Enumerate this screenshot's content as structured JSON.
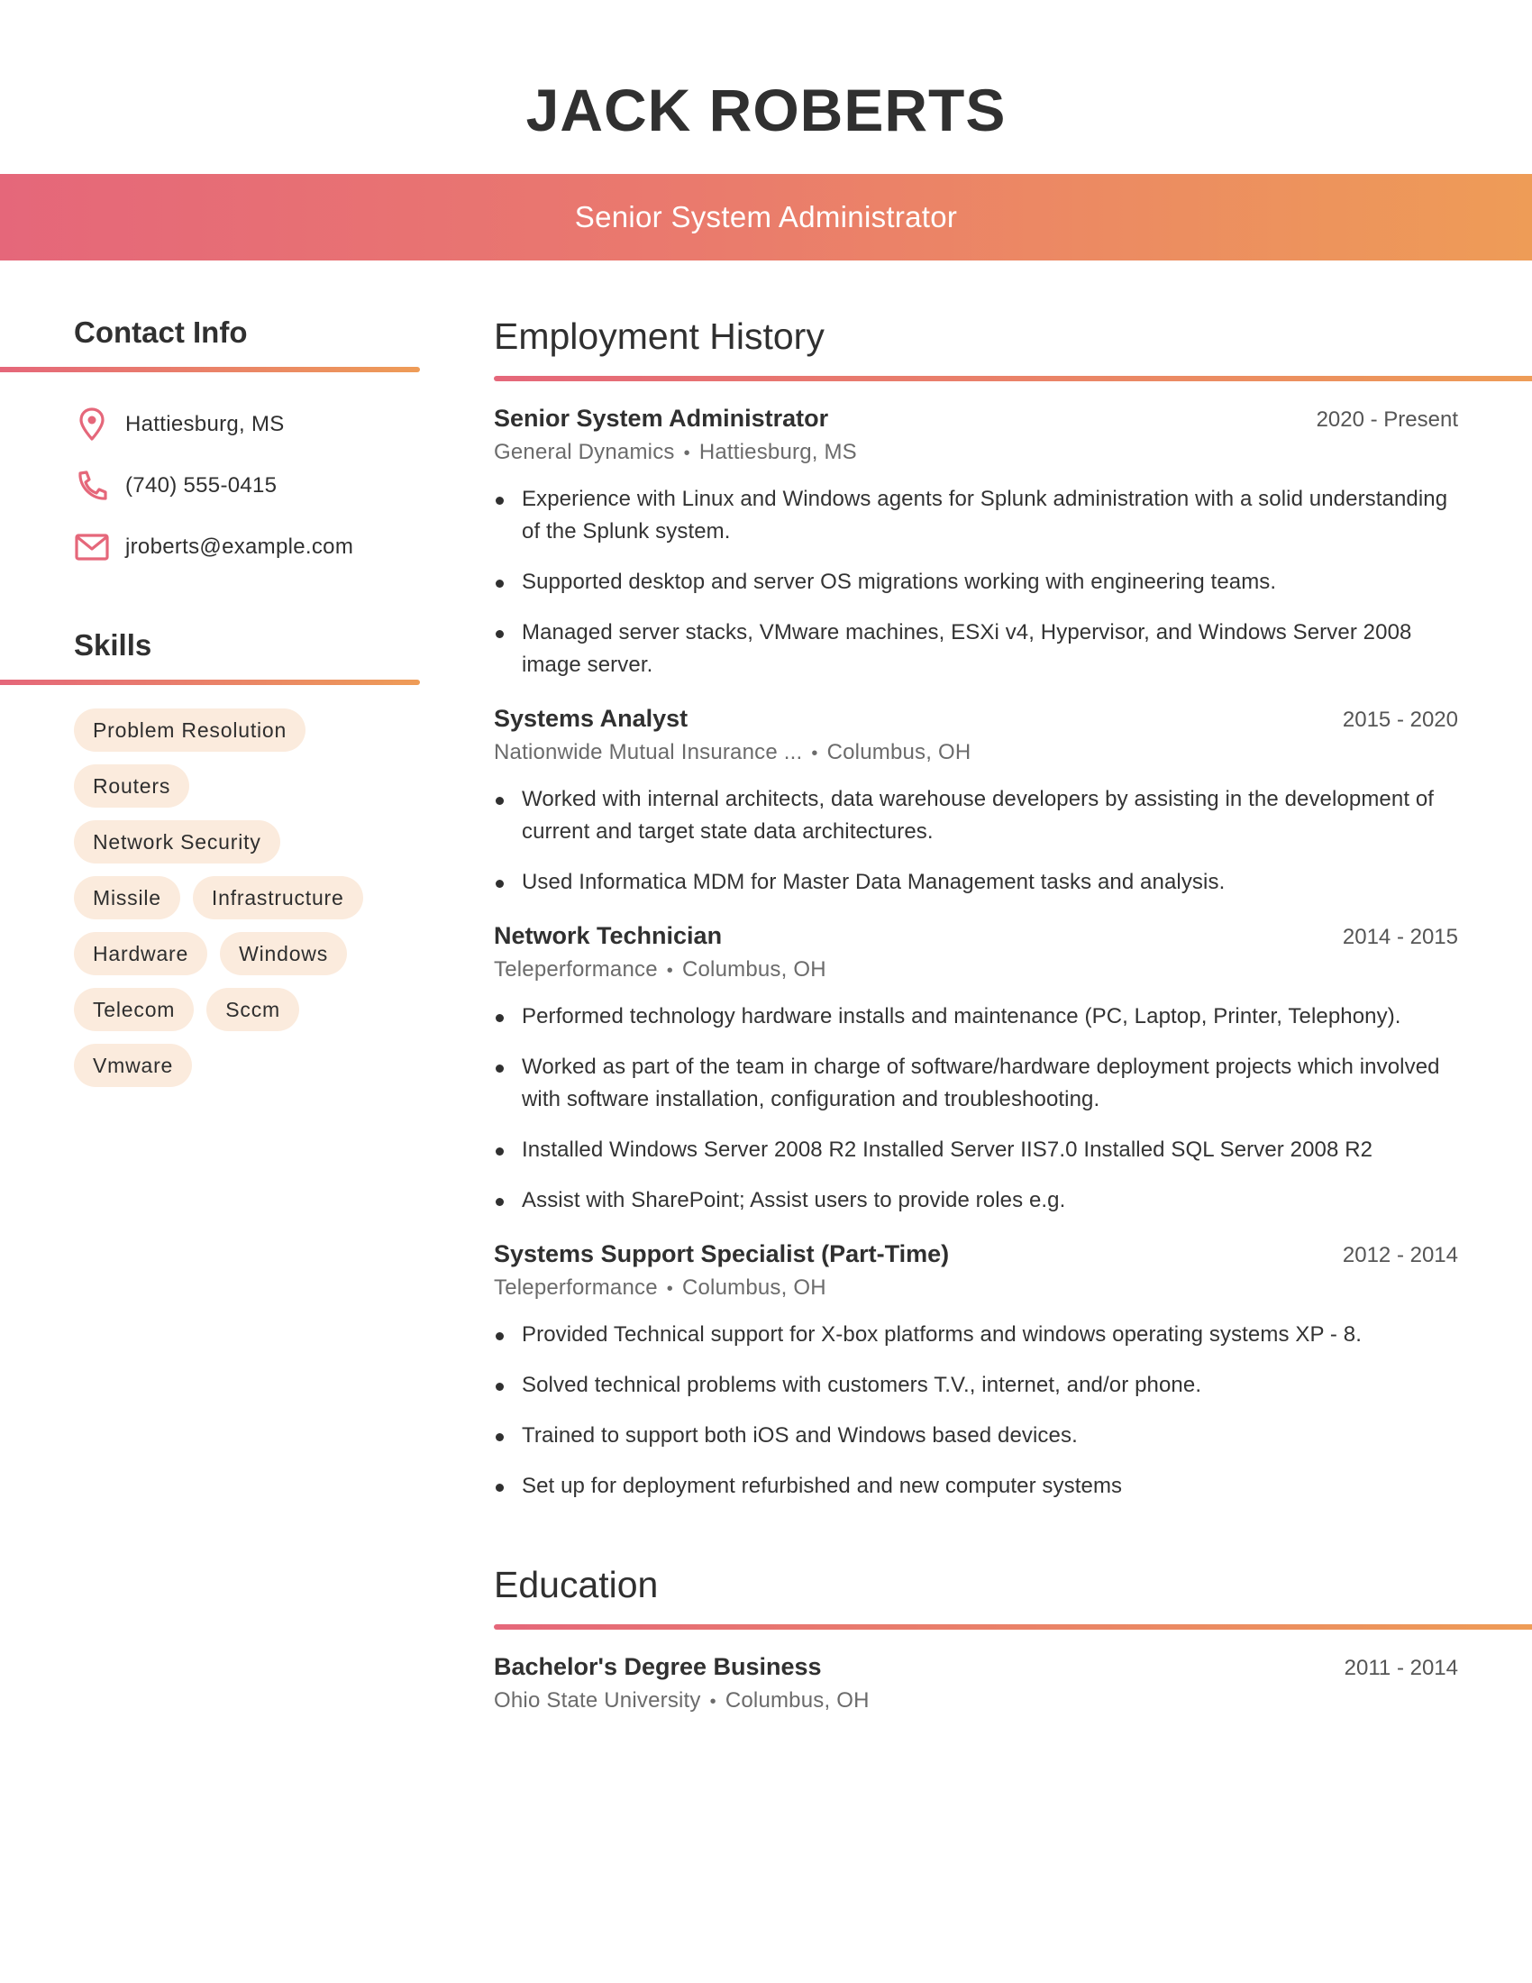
{
  "header": {
    "name": "JACK ROBERTS",
    "title": "Senior System Administrator",
    "gradient_colors": [
      "#e5677a",
      "#ee9c57"
    ]
  },
  "contact": {
    "heading": "Contact Info",
    "items": [
      {
        "icon": "location-pin-icon",
        "text": "Hattiesburg, MS"
      },
      {
        "icon": "phone-icon",
        "text": "(740) 555-0415"
      },
      {
        "icon": "email-icon",
        "text": "jroberts@example.com"
      }
    ],
    "icon_color": "#e5677a"
  },
  "skills": {
    "heading": "Skills",
    "items": [
      "Problem Resolution",
      "Routers",
      "Network Security",
      "Missile",
      "Infrastructure",
      "Hardware",
      "Windows",
      "Telecom",
      "Sccm",
      "Vmware"
    ],
    "chip_color": "#fbebdd"
  },
  "employment": {
    "heading": "Employment History",
    "jobs": [
      {
        "title": "Senior System Administrator",
        "dates": "2020 - Present",
        "company": "General Dynamics",
        "location": "Hattiesburg, MS",
        "bullets": [
          "Experience with Linux and Windows agents for Splunk administration with a solid understanding of the Splunk system.",
          "Supported desktop and server OS migrations working with engineering teams.",
          "Managed server stacks, VMware machines, ESXi v4, Hypervisor, and Windows Server 2008 image server."
        ]
      },
      {
        "title": "Systems Analyst",
        "dates": "2015 - 2020",
        "company": "Nationwide Mutual Insurance ...",
        "location": "Columbus, OH",
        "bullets": [
          "Worked with internal architects, data warehouse developers by assisting in the development of current and target state data architectures.",
          "Used Informatica MDM for Master Data Management tasks and analysis."
        ]
      },
      {
        "title": "Network Technician",
        "dates": "2014 - 2015",
        "company": "Teleperformance",
        "location": "Columbus, OH",
        "bullets": [
          "Performed technology hardware installs and maintenance (PC, Laptop, Printer, Telephony).",
          "Worked as part of the team in charge of software/hardware deployment projects which involved with software installation, configuration and troubleshooting.",
          "Installed Windows Server 2008 R2 Installed Server IIS7.0 Installed SQL Server 2008 R2",
          "Assist with SharePoint; Assist users to provide roles e.g."
        ]
      },
      {
        "title": "Systems Support Specialist (Part-Time)",
        "dates": "2012 - 2014",
        "company": "Teleperformance",
        "location": "Columbus, OH",
        "bullets": [
          "Provided Technical support for X-box platforms and windows operating systems XP - 8.",
          "Solved technical problems with customers T.V., internet, and/or phone.",
          "Trained to support both iOS and Windows based devices.",
          "Set up for deployment refurbished and new computer systems"
        ]
      }
    ]
  },
  "education": {
    "heading": "Education",
    "entries": [
      {
        "degree": "Bachelor's Degree Business",
        "dates": "2011 - 2014",
        "school": "Ohio State University",
        "location": "Columbus, OH"
      }
    ]
  },
  "separator": "•"
}
